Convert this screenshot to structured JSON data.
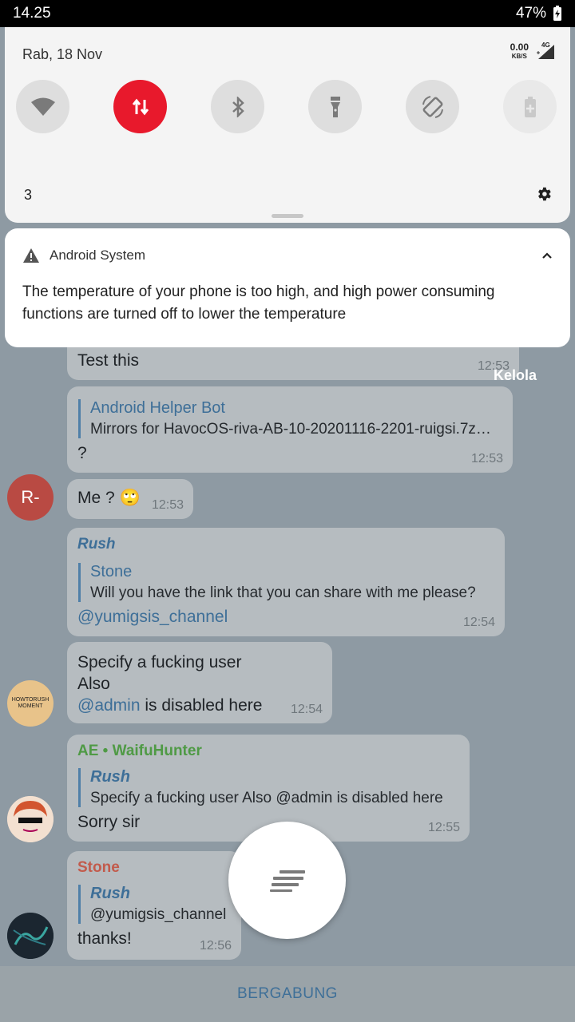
{
  "status_bar": {
    "time": "14.25",
    "battery": "47%"
  },
  "quick_settings": {
    "date": "Rab, 18 Nov",
    "net_speed_value": "0.00",
    "net_speed_unit": "KB/S",
    "network_type": "4G",
    "count": "3",
    "tiles": [
      "wifi-icon",
      "mobile-data-icon",
      "bluetooth-icon",
      "flashlight-icon",
      "auto-rotate-icon",
      "battery-saver-icon"
    ],
    "active_color": "#e8192c"
  },
  "notification": {
    "app": "Android System",
    "body": "The temperature of your phone is too high, and high power consuming functions are turned off to lower the temperature"
  },
  "manage_label": "Kelola",
  "chat": {
    "msg1": {
      "text": "Test this",
      "time": "12:53"
    },
    "msg2": {
      "reply_name": "Android Helper Bot",
      "reply_text": "Mirrors for HavocOS-riva-AB-10-20201116-2201-ruigsi.7z…",
      "text": "?",
      "time": "12:53"
    },
    "msg3": {
      "avatar": "R-",
      "text": "Me ?",
      "emoji": "🙄",
      "time": "12:53"
    },
    "msg4": {
      "sender": "Rush",
      "reply_name": "Stone",
      "reply_text": "Will you have the link that you can share with me please?",
      "text": "@yumigsis_channel",
      "time": "12:54"
    },
    "msg5": {
      "line1": "Specify a fucking user",
      "line2": "Also",
      "mention": "@admin",
      "line3_rest": " is disabled here",
      "time": "12:54",
      "avatar_text": "HOWTORUSH MOMENT"
    },
    "msg6": {
      "sender": "AE • WaifuHunter",
      "reply_name": "Rush",
      "reply_text": "Specify a fucking user Also @admin is disabled here",
      "text": "Sorry sir",
      "time": "12:55"
    },
    "msg7": {
      "sender": "Stone",
      "reply_name": "Rush",
      "reply_text": "@yumigsis_channel",
      "text": "thanks!",
      "time": "12:56"
    }
  },
  "join_label": "BERGABUNG"
}
